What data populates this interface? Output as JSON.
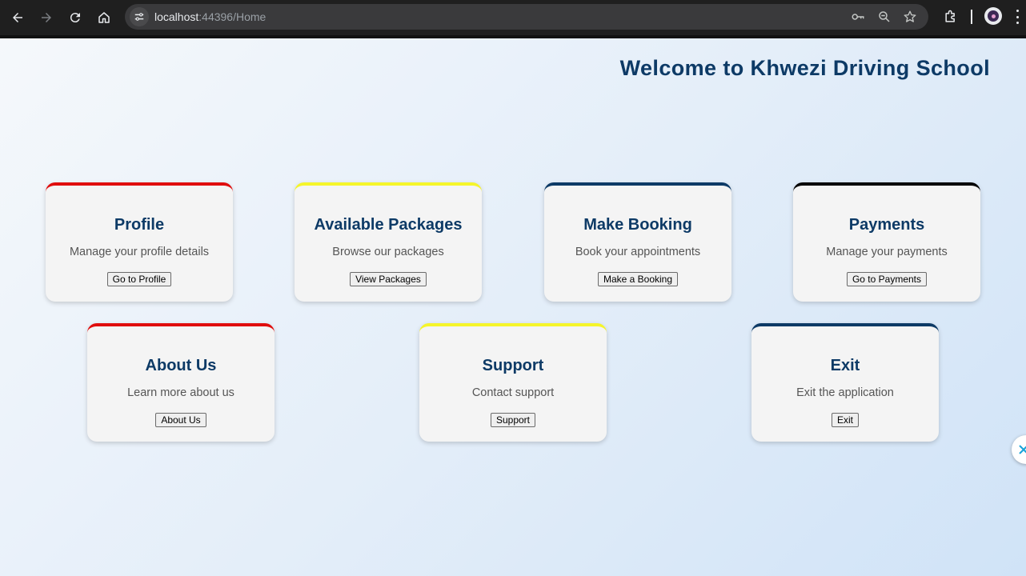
{
  "browser": {
    "url_host": "localhost",
    "url_path": ":44396/Home"
  },
  "page": {
    "title": "Welcome to Khwezi Driving School"
  },
  "cards": [
    {
      "title": "Profile",
      "description": "Manage your profile details",
      "button": "Go to Profile",
      "accent": "#e00d0d"
    },
    {
      "title": "Available Packages",
      "description": "Browse our packages",
      "button": "View Packages",
      "accent": "#f5f52a"
    },
    {
      "title": "Make Booking",
      "description": "Book your appointments",
      "button": "Make a Booking",
      "accent": "#0d3a66"
    },
    {
      "title": "Payments",
      "description": "Manage your payments",
      "button": "Go to Payments",
      "accent": "#000000"
    },
    {
      "title": "About Us",
      "description": "Learn more about us",
      "button": "About Us",
      "accent": "#e00d0d"
    },
    {
      "title": "Support",
      "description": "Contact support",
      "button": "Support",
      "accent": "#f5f52a"
    },
    {
      "title": "Exit",
      "description": "Exit the application",
      "button": "Exit",
      "accent": "#0d3a66"
    }
  ],
  "colors": {
    "heading": "#0d3a66",
    "card_bg": "#f4f4f4"
  }
}
